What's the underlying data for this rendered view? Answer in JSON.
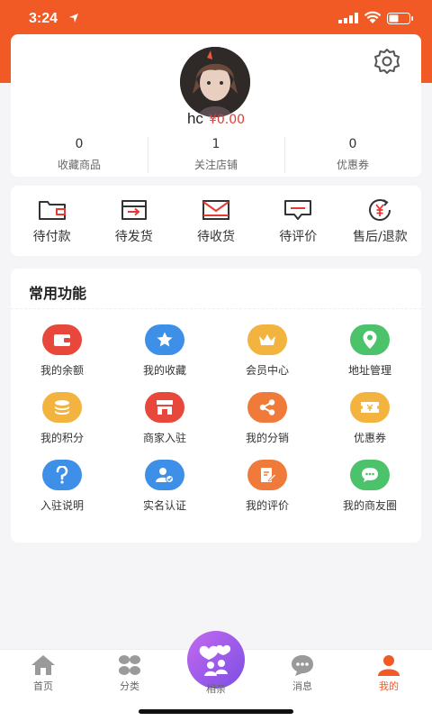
{
  "status_bar": {
    "time": "3:24"
  },
  "profile": {
    "name": "hc",
    "balance": "¥0.00",
    "stats": [
      {
        "count": "0",
        "label": "收藏商品"
      },
      {
        "count": "1",
        "label": "关注店铺"
      },
      {
        "count": "0",
        "label": "优惠券"
      }
    ]
  },
  "orders": [
    {
      "label": "待付款",
      "icon": "wallet-outline-icon"
    },
    {
      "label": "待发货",
      "icon": "card-arrow-icon"
    },
    {
      "label": "待收货",
      "icon": "envelope-icon"
    },
    {
      "label": "待评价",
      "icon": "comment-icon"
    },
    {
      "label": "售后/退款",
      "icon": "yen-refresh-icon"
    }
  ],
  "features": {
    "title": "常用功能",
    "items": [
      {
        "label": "我的余额",
        "icon": "wallet-icon",
        "color": "#e8483b"
      },
      {
        "label": "我的收藏",
        "icon": "star-icon",
        "color": "#3d8fe8"
      },
      {
        "label": "会员中心",
        "icon": "crown-icon",
        "color": "#f3b43f"
      },
      {
        "label": "地址管理",
        "icon": "location-pin-icon",
        "color": "#4cc26a"
      },
      {
        "label": "我的积分",
        "icon": "coins-icon",
        "color": "#f3b43f"
      },
      {
        "label": "商家入驻",
        "icon": "shop-icon",
        "color": "#e8483b"
      },
      {
        "label": "我的分销",
        "icon": "share-icon",
        "color": "#f07a3a"
      },
      {
        "label": "优惠券",
        "icon": "coupon-icon",
        "color": "#f3b43f"
      },
      {
        "label": "入驻说明",
        "icon": "question-icon",
        "color": "#3d8fe8"
      },
      {
        "label": "实名认证",
        "icon": "user-verified-icon",
        "color": "#3d8fe8"
      },
      {
        "label": "我的评价",
        "icon": "edit-note-icon",
        "color": "#f07a3a"
      },
      {
        "label": "我的商友圈",
        "icon": "chat-bubble-icon",
        "color": "#4cc26a"
      }
    ]
  },
  "tabbar": {
    "items": [
      {
        "label": "首页",
        "icon": "home-icon"
      },
      {
        "label": "分类",
        "icon": "category-icon"
      },
      {
        "label": "相亲",
        "icon": "couple-hearts-icon"
      },
      {
        "label": "消息",
        "icon": "message-icon"
      },
      {
        "label": "我的",
        "icon": "user-icon"
      }
    ]
  },
  "colors": {
    "brand": "#f15a24",
    "price": "#e53935"
  }
}
